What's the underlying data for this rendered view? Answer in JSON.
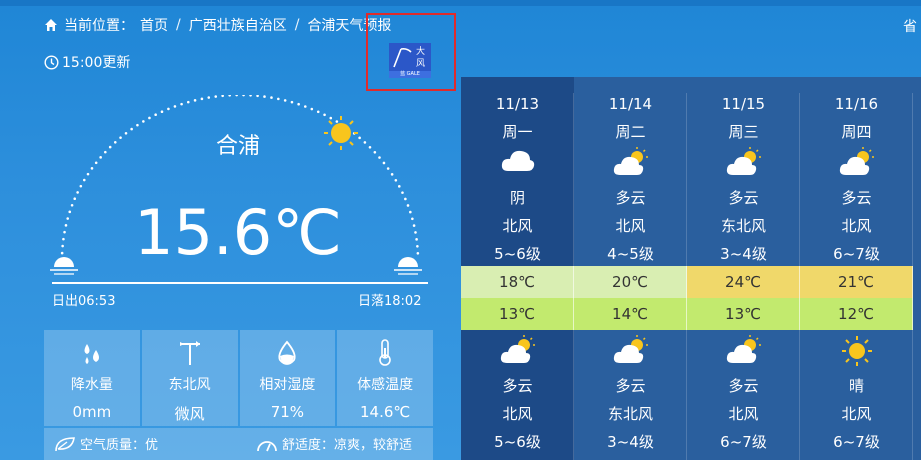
{
  "breadcrumb": {
    "prefix": "当前位置：",
    "items": [
      "首页",
      "广西壮族自治区",
      "合浦天气预报"
    ],
    "sep": "/"
  },
  "side_text": "省",
  "update_time": "15:00更新",
  "alert": {
    "title_line1": "大",
    "title_line2": "风",
    "color": "#2b57c8",
    "footer": "蓝 GALE"
  },
  "current": {
    "city": "合浦",
    "temperature": "15.6℃",
    "sunrise": "日出06:53",
    "sunset": "日落18:02"
  },
  "stats": [
    {
      "icon": "raindrops-icon",
      "label": "降水量",
      "value": "0mm"
    },
    {
      "icon": "windvane-icon",
      "label": "东北风",
      "value": "微风"
    },
    {
      "icon": "humidity-icon",
      "label": "相对湿度",
      "value": "71%"
    },
    {
      "icon": "thermometer-icon",
      "label": "体感温度",
      "value": "14.6℃"
    }
  ],
  "air_quality": "空气质量：优",
  "comfort": "舒适度：凉爽，较舒适",
  "forecast": [
    {
      "date": "11/13",
      "weekday": "周一",
      "day_icon": "cloudy-icon",
      "day_weather": "阴",
      "day_wind": "北风",
      "day_level": "5~6级",
      "high": "18℃",
      "high_color": "#d9eeb2",
      "low": "13℃",
      "low_color": "#c2ea6e",
      "night_icon": "partly-cloudy-icon",
      "night_weather": "多云",
      "night_wind": "北风",
      "night_level": "5~6级"
    },
    {
      "date": "11/14",
      "weekday": "周二",
      "day_icon": "partly-cloudy-icon",
      "day_weather": "多云",
      "day_wind": "北风",
      "day_level": "4~5级",
      "high": "20℃",
      "high_color": "#d9eeb2",
      "low": "14℃",
      "low_color": "#c2ea6e",
      "night_icon": "partly-cloudy-icon",
      "night_weather": "多云",
      "night_wind": "东北风",
      "night_level": "3~4级"
    },
    {
      "date": "11/15",
      "weekday": "周三",
      "day_icon": "partly-cloudy-icon",
      "day_weather": "多云",
      "day_wind": "东北风",
      "day_level": "3~4级",
      "high": "24℃",
      "high_color": "#f0d86a",
      "low": "13℃",
      "low_color": "#c2ea6e",
      "night_icon": "partly-cloudy-icon",
      "night_weather": "多云",
      "night_wind": "北风",
      "night_level": "6~7级"
    },
    {
      "date": "11/16",
      "weekday": "周四",
      "day_icon": "partly-cloudy-icon",
      "day_weather": "多云",
      "day_wind": "北风",
      "day_level": "6~7级",
      "high": "21℃",
      "high_color": "#f0d86a",
      "low": "12℃",
      "low_color": "#c2ea6e",
      "night_icon": "sunny-icon",
      "night_weather": "晴",
      "night_wind": "北风",
      "night_level": "6~7级"
    }
  ]
}
